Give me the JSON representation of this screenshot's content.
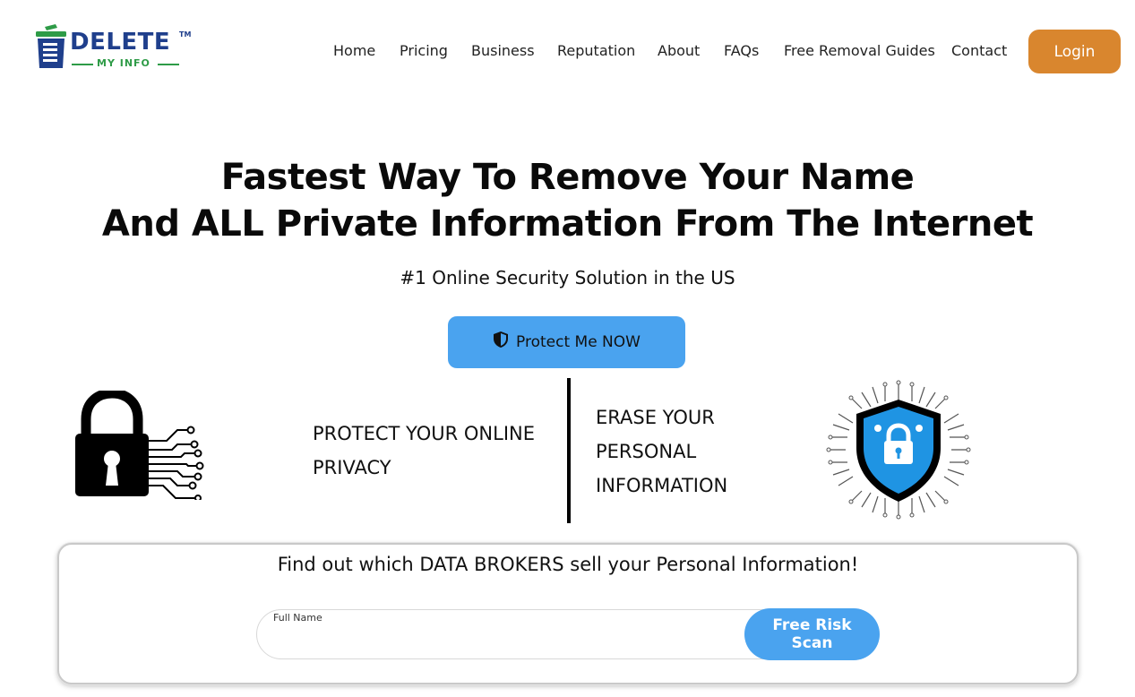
{
  "brand": {
    "name": "DELETE",
    "tagline": "MY INFO",
    "trademark": "TM",
    "primary_color": "#1f3f8c",
    "secondary_color": "#2e9b47"
  },
  "nav": {
    "items": [
      {
        "label": "Home"
      },
      {
        "label": "Pricing"
      },
      {
        "label": "Business"
      },
      {
        "label": "Reputation"
      },
      {
        "label": "About"
      },
      {
        "label": "FAQs"
      },
      {
        "label": "Free Removal Guides"
      },
      {
        "label": "Contact"
      }
    ],
    "login_label": "Login",
    "login_color": "#d9862e"
  },
  "hero": {
    "title_line1": "Fastest Way To Remove Your Name",
    "title_line2": "And ALL Private Information From The Internet",
    "subtitle": "#1 Online Security Solution in the US",
    "cta_label": "Protect Me NOW",
    "cta_icon": "shield-icon",
    "cta_color": "#4aa3ef"
  },
  "features": {
    "left_text": "PROTECT YOUR ONLINE PRIVACY",
    "left_icon": "padlock-circuit-icon",
    "right_text": "ERASE YOUR PERSONAL INFORMATION",
    "right_icon": "shield-lock-circuit-icon"
  },
  "scan": {
    "title": "Find out which DATA BROKERS sell your Personal Information!",
    "field_label": "Full Name",
    "field_value": "",
    "button_label": "Free Risk Scan"
  }
}
